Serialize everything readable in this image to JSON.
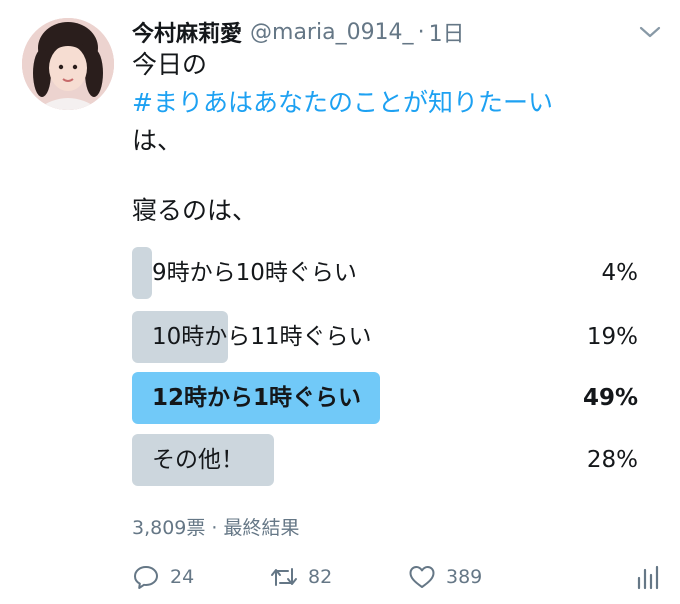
{
  "tweet": {
    "author_name": "今村麻莉愛",
    "handle": "@maria_0914_",
    "separator": "·",
    "time": "1日",
    "line1": "今日の",
    "hashtag": "#まりあはあなたのことが知りたーい",
    "line3": "は、",
    "line4": "寝るのは、"
  },
  "poll": {
    "options": [
      {
        "label": "9時から10時ぐらい",
        "percent_text": "4%",
        "fraction": 0.04,
        "winner": false
      },
      {
        "label": "10時から11時ぐらい",
        "percent_text": "19%",
        "fraction": 0.19,
        "winner": false
      },
      {
        "label": "12時から1時ぐらい",
        "percent_text": "49%",
        "fraction": 0.49,
        "winner": true
      },
      {
        "label": "その他！",
        "percent_text": "28%",
        "fraction": 0.28,
        "winner": false
      }
    ],
    "summary": "3,809票 · 最終結果"
  },
  "actions": {
    "reply_count": "24",
    "retweet_count": "82",
    "like_count": "389"
  },
  "colors": {
    "accent": "#1da1f2",
    "winner_bar": "#71c9f8",
    "bar": "#ccd6dd",
    "secondary_text": "#657786"
  },
  "icons": [
    "reply-icon",
    "retweet-icon",
    "like-icon",
    "analytics-icon",
    "chevron-down-icon"
  ]
}
